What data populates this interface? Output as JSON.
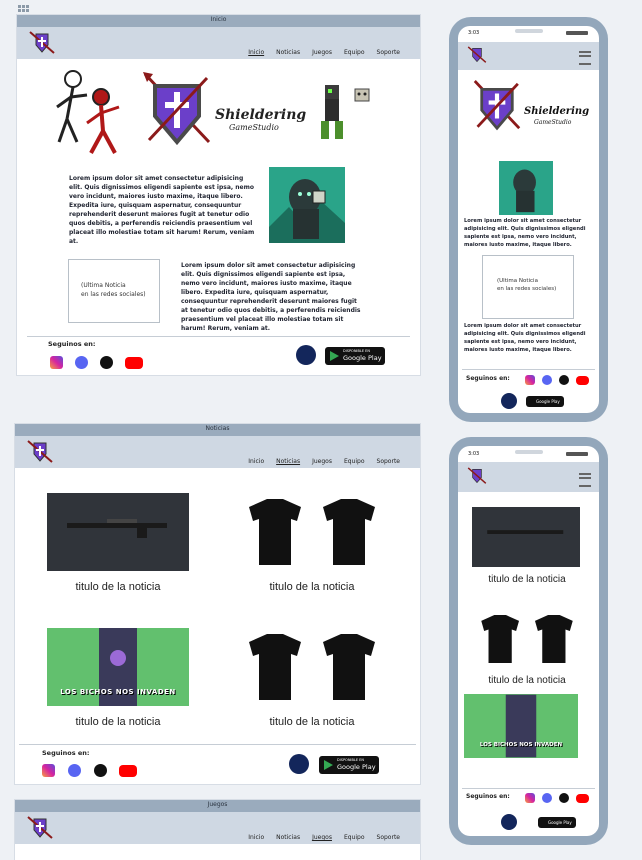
{
  "windows": {
    "inicio": {
      "title": "Inicio"
    },
    "noticias": {
      "title": "Noticias"
    },
    "juegos": {
      "title": "Juegos"
    }
  },
  "nav": {
    "items": [
      "Inicio",
      "Noticias",
      "Juegos",
      "Equipo",
      "Soporte"
    ]
  },
  "brand": {
    "name": "Shieldering",
    "sub": "GameStudio"
  },
  "lorem": {
    "p1": "Lorem ipsum dolor sit amet consectetur adipisicing elit. Quis dignissimos eligendi sapiente est ipsa, nemo vero incidunt, maiores iusto maxime, itaque libero. Expedita iure, quisquam aspernatur, consequuntur reprehenderit deserunt maiores fugit at tenetur odio quos debitis, a perferendis reiciendis praesentium vel placeat illo molestiae totam sit harum! Rerum, veniam at.",
    "mobile": "Lorem ipsum dolor sit amet consectetur adipisicing elit. Quis dignissimos eligendi sapiente est ipsa, nemo vero incidunt, maiores iusto maxime, itaque libero."
  },
  "news_box": {
    "line1": "(Ultima Noticia",
    "line2": "en las redes sociales)"
  },
  "footer": {
    "follow": "Seguinos en:",
    "gp_small": "DISPONIBLE EN",
    "gp_big": "Google Play"
  },
  "news": {
    "item_title": "titulo de la noticia",
    "banner_text": "LOS BICHOS NOS INVADEN"
  },
  "phone": {
    "time": "3:03"
  },
  "colors": {
    "nav": "#cfd8e3",
    "titlebar": "#9aabbd",
    "phone": "#93a7bb",
    "accent_purple": "#6b3fc9"
  }
}
